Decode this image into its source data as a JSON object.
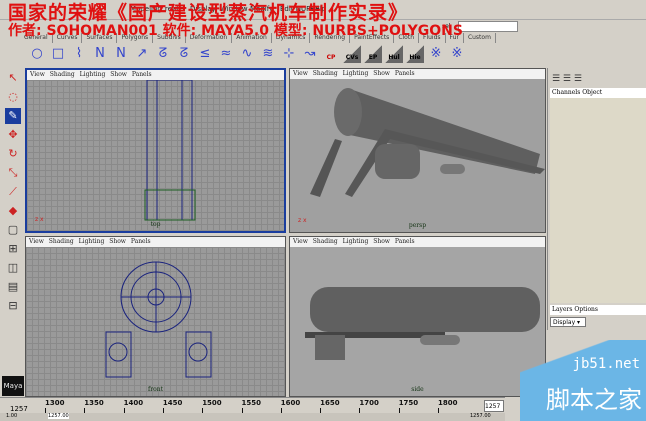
{
  "menubar": {
    "items": [
      "Modeling",
      "Create",
      "Display",
      "Window",
      "Modify",
      "Edit NURBS",
      "Help"
    ]
  },
  "overlay": {
    "title": "国家的荣耀《国产建设型蒸汽机车制作实录》",
    "credits": "作者: SOHOMAN001   软件: MAYA5.0   模型: NURBS+POLYGONS"
  },
  "status": {
    "mode": "Modeling",
    "sel_label": "sel"
  },
  "shelf_tabs": [
    "General",
    "Curves",
    "Surfaces",
    "Polygons",
    "Subdivs",
    "Deformation",
    "Animation",
    "Dynamics",
    "Rendering",
    "PaintEffects",
    "Cloth",
    "Fluids",
    "Fur",
    "Custom"
  ],
  "shelf_text_buttons": [
    "CP",
    "CVs",
    "EP",
    "Hul",
    "Hie"
  ],
  "viewport": {
    "menu": "View Shading Lighting Show Panels",
    "cameras": [
      "top",
      "persp",
      "front",
      "side"
    ]
  },
  "channel_box": {
    "header": "Channels Object"
  },
  "layers": {
    "header": "Layers Options",
    "display": "Display"
  },
  "timeline": {
    "ticks": [
      "1300",
      "1350",
      "1400",
      "1450",
      "1500",
      "1550",
      "1600",
      "1650",
      "1700",
      "1750",
      "1800"
    ],
    "current": "1257",
    "end_field": "1257",
    "range_start": "1.00",
    "range_field": "1257.00",
    "range_end": "1257.00"
  },
  "logo": "Maya",
  "watermark": {
    "site": "jb51.net",
    "name": "脚本之家"
  }
}
